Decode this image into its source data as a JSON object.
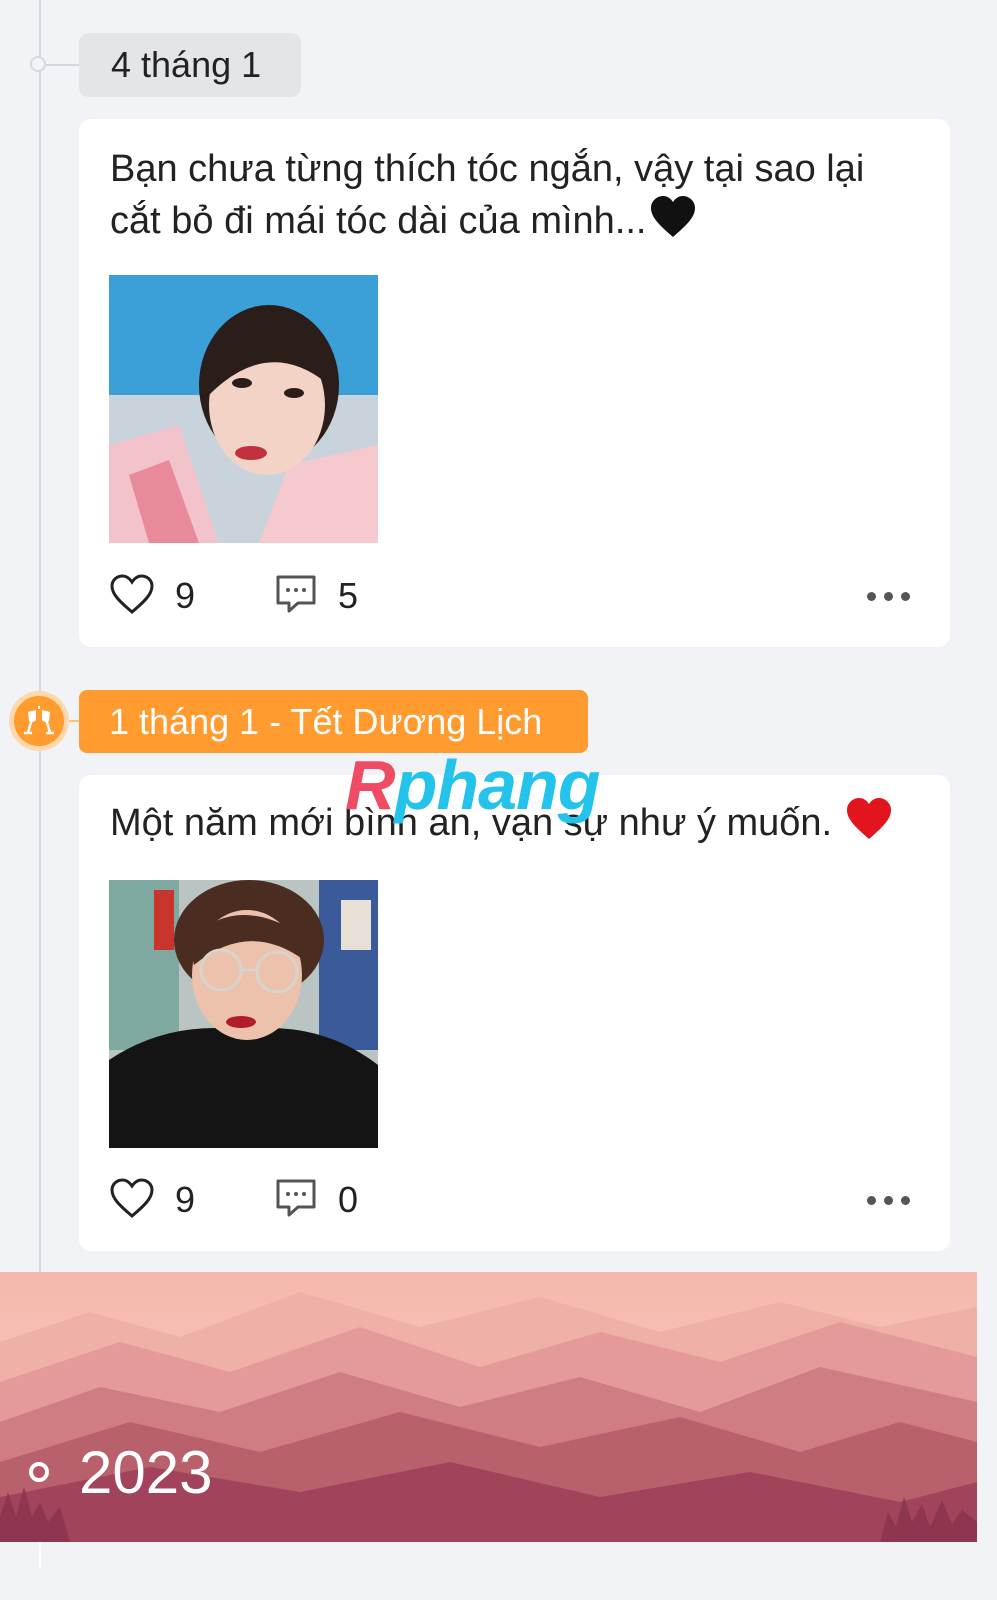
{
  "entries": [
    {
      "date_label": "4 tháng 1",
      "text": "Bạn chưa từng thích tóc ngắn, vậy tại sao lại cắt bỏ đi mái tóc dài của mình...",
      "text_emoji": "black-heart",
      "likes": "9",
      "comments": "5"
    },
    {
      "date_label": "1 tháng 1 - Tết Dương Lịch",
      "holiday_icon": "cheers-icon",
      "text": "Một năm mới bình an, vạn sự như ý muốn. ",
      "text_emoji": "red-heart",
      "likes": "9",
      "comments": "0"
    }
  ],
  "watermark": {
    "part1": "R",
    "part2": "phang"
  },
  "year_banner": {
    "year": "2023"
  },
  "colors": {
    "background": "#f2f3f7",
    "holiday_accent": "#ff9b2f",
    "card": "#ffffff",
    "banner_top": "#f3b3a8",
    "banner_bottom": "#a1374f"
  }
}
